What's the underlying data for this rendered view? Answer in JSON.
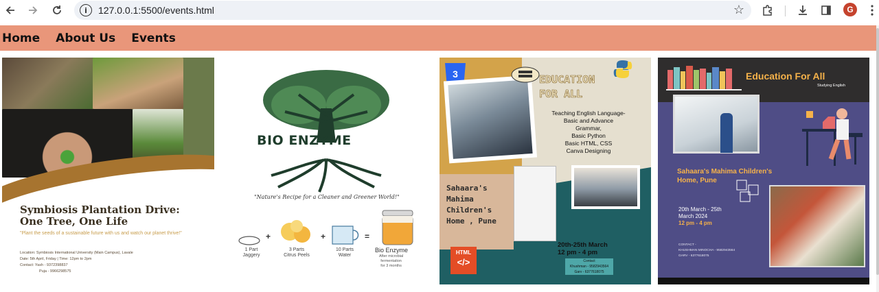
{
  "browser": {
    "url": "127.0.0.1:5500/events.html",
    "profile_initial": "G",
    "profile_color": "#c5432e"
  },
  "nav": {
    "items": [
      "Home",
      "About Us",
      "Events"
    ],
    "bg_color": "#e9967a"
  },
  "posters": {
    "plantation": {
      "title_line1": "Symbiosis Plantation Drive:",
      "title_line2": "One Tree, One Life",
      "quote": "\"Plant the seeds of a sustainable future with us and watch our planet thrive!\"",
      "location": "Location: Symbiosis International University (Main Campus), Lavale",
      "date": "Date: 5th April, Friday | Time: 12pm to 2pm",
      "contact1": "Contact: Yash - 9372398837",
      "contact2": "Puja - 9966298575"
    },
    "bio_enzyme": {
      "title": "BIO ENZYME",
      "quote": "\"Nature's Recipe for a Cleaner and Greener World!\"",
      "ing1_a": "1 Part",
      "ing1_b": "Jaggery",
      "ing2_a": "3 Parts",
      "ing2_b": "Citrus Peels",
      "ing3_a": "10 Parts",
      "ing3_b": "Water",
      "plus": "+",
      "equals": "=",
      "result": "Bio Enzyme",
      "result_sub1": "After microbial",
      "result_sub2": "fermentation",
      "result_sub3": "for 3 months"
    },
    "education1": {
      "css_badge": "3",
      "title_line1": "EDUCATION",
      "title_line2": "FOR ALL",
      "teach1": "Teaching English Language-",
      "teach2": "Basic and Advance",
      "teach3": "Grammar,",
      "teach4": "Basic Python",
      "teach5": "Basic HTML, CSS",
      "teach6": "Canva Designing",
      "place1": "Sahaara's",
      "place2": "Mahima",
      "place3": "Children's",
      "place4": "Home , Pune",
      "dates": "20th-25th March",
      "time": "12 pm - 4 pm",
      "contact_label": "Contact",
      "contact1": "Khushman - 9582943564",
      "contact2": "Garv - 6377618075",
      "html_badge": "HTML",
      "html_glyph": "</>"
    },
    "education2": {
      "title": "Education For All",
      "sub": "Studying English",
      "place1": "Sahaara's Mahima Children's",
      "place2": "Home, Pune",
      "dates1": "20th March - 25th",
      "dates2": "March 2024",
      "time": "12 pm - 4 pm",
      "contact_label": "CONTACT -",
      "contact1": "KHUSHMAN MINOCHA - 9582943564",
      "contact2": "GARV - 6377618075"
    }
  }
}
